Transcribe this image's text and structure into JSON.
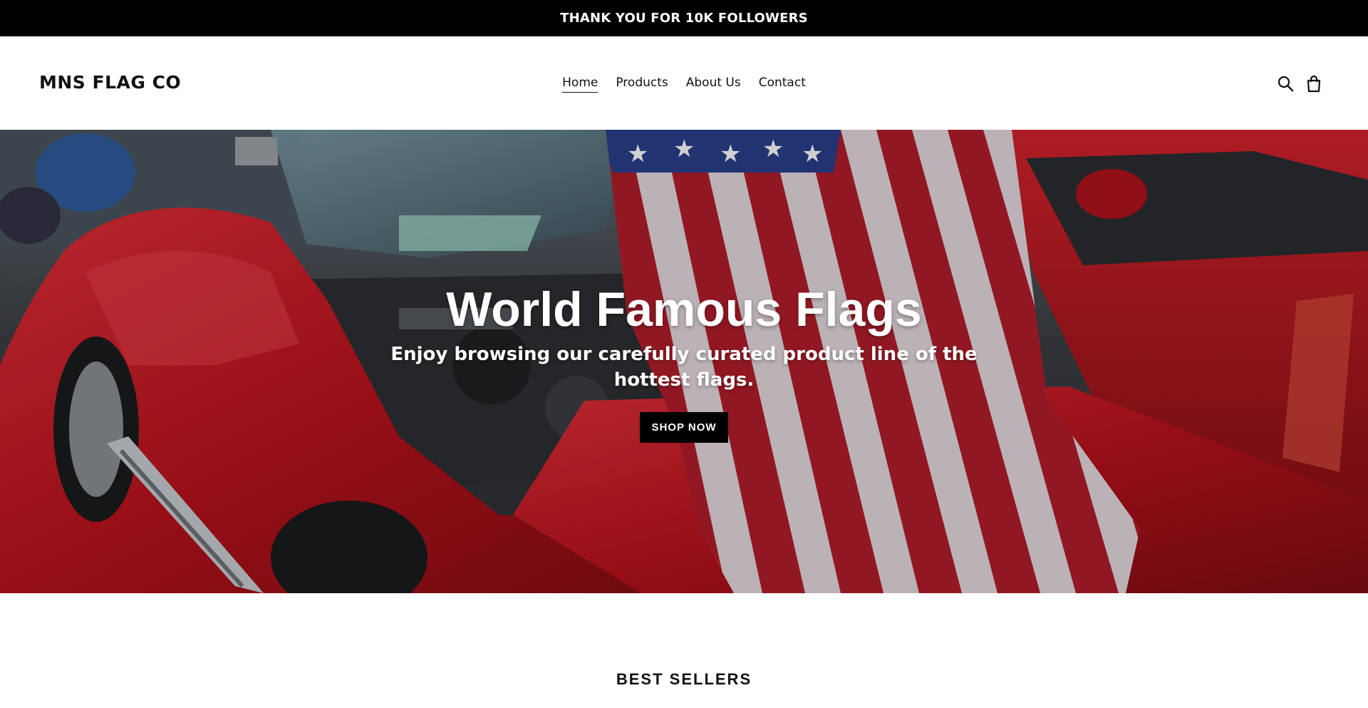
{
  "announcement": {
    "text": "THANK YOU FOR 10K FOLLOWERS"
  },
  "header": {
    "logo": "MNS FLAG CO",
    "nav": [
      {
        "label": "Home",
        "active": true
      },
      {
        "label": "Products",
        "active": false
      },
      {
        "label": "About Us",
        "active": false
      },
      {
        "label": "Contact",
        "active": false
      }
    ],
    "icons": {
      "search": "search-icon",
      "cart": "shopping-bag-icon"
    }
  },
  "hero": {
    "title": "World Famous Flags",
    "subtitle": "Enjoy browsing our carefully curated product line of the hottest flags.",
    "button_label": "SHOP NOW",
    "background": "red-corvette-with-american-flag-photo"
  },
  "best_sellers": {
    "title": "BEST SELLERS"
  },
  "colors": {
    "announcement_bg": "#000000",
    "button_bg": "#000000",
    "text": "#111111",
    "car_red": "#c4141e"
  }
}
